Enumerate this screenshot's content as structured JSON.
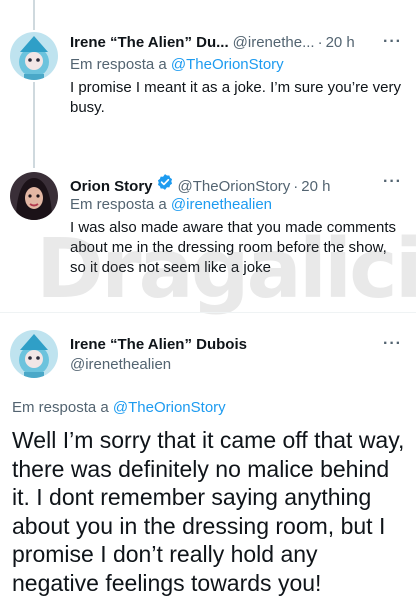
{
  "tweets": [
    {
      "name": "Irene “The Alien” Du...",
      "handle": "@irenethe...",
      "time": "20 h",
      "reply_prefix": "Em resposta a",
      "reply_to": "@TheOrionStory",
      "text": "I promise I meant it as a joke. I’m sure you’re very busy."
    },
    {
      "name": "Orion Story",
      "handle": "@TheOrionStory",
      "time": "20 h",
      "reply_prefix": "Em resposta a",
      "reply_to": "@irenethealien",
      "text": "I was also made aware that you made comments about me in the dressing room before the show, so it does not seem like a joke"
    }
  ],
  "main_tweet": {
    "name": "Irene “The Alien” Dubois",
    "handle": "@irenethealien",
    "reply_prefix": "Em resposta a",
    "reply_to": "@TheOrionStory",
    "text": "Well I’m sorry that it came off that way, there was definitely no malice behind it. I dont remember saying anything about you in the dressing room, but I promise I don’t really hold any negative feelings towards you!"
  },
  "more_glyph": "···",
  "dot": "·",
  "watermark": "Dragalicious",
  "colors": {
    "link": "#1d9bf0",
    "muted": "#536471",
    "verified": "#1d9bf0"
  }
}
